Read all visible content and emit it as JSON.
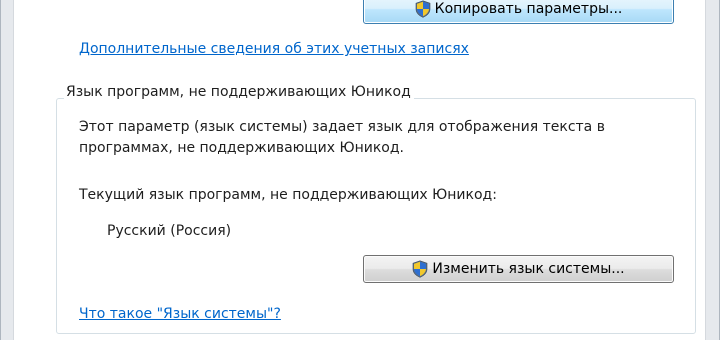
{
  "copy_settings_button": {
    "label": "Копировать параметры..."
  },
  "more_info_link": "Дополнительные сведения об этих учетных записях",
  "non_unicode_group": {
    "title": "Язык программ, не поддерживающих Юникод",
    "description": "Этот параметр (язык системы) задает язык для отображения текста в программах, не поддерживающих Юникод.",
    "current_label": "Текущий язык программ, не поддерживающих Юникод:",
    "current_value": "Русский (Россия)",
    "change_button": {
      "label": "Изменить язык системы..."
    },
    "help_link": "Что такое \"Язык системы\"?"
  },
  "icons": {
    "button_icon": "uac-shield-icon"
  },
  "colors": {
    "link": "#0066cc",
    "hover_button_border": "#3c7fb1"
  }
}
